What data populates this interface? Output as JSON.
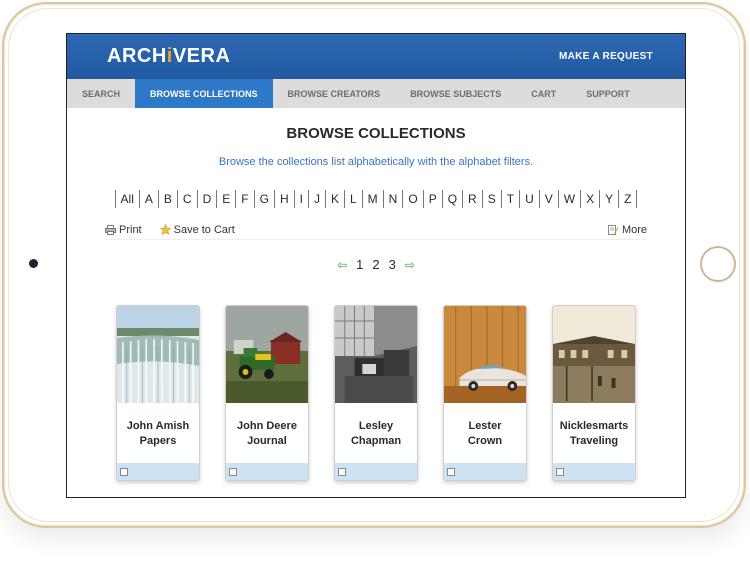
{
  "app": {
    "logo": {
      "part1": "ARCH",
      "part2": "i",
      "part3": "VERA"
    },
    "header_link": "MAKE A REQUEST"
  },
  "nav": {
    "items": [
      "SEARCH",
      "BROWSE COLLECTIONS",
      "BROWSE CREATORS",
      "BROWSE SUBJECTS",
      "CART",
      "SUPPORT"
    ],
    "active": "BROWSE COLLECTIONS"
  },
  "page": {
    "title": "BROWSE COLLECTIONS",
    "subtitle": "Browse the collections list alphabetically with the alphabet filters."
  },
  "alphabet": [
    "All",
    "A",
    "B",
    "C",
    "D",
    "E",
    "F",
    "G",
    "H",
    "I",
    "J",
    "K",
    "L",
    "M",
    "N",
    "O",
    "P",
    "Q",
    "R",
    "S",
    "T",
    "U",
    "V",
    "W",
    "X",
    "Y",
    "Z"
  ],
  "toolbar": {
    "print": "Print",
    "save": "Save to Cart",
    "more": "More"
  },
  "pager": {
    "prev_icon": "left-arrow-icon",
    "next_icon": "right-arrow-icon",
    "pages": [
      "1",
      "2",
      "3"
    ]
  },
  "collections": [
    {
      "title_line1": "John Amish",
      "title_line2": "Papers",
      "image": "waterfall-photo"
    },
    {
      "title_line1": "John Deere",
      "title_line2": "Journal",
      "image": "tractor-photo"
    },
    {
      "title_line1": "Lesley",
      "title_line2": "Chapman",
      "image": "office-bw-photo"
    },
    {
      "title_line1": "Lester",
      "title_line2": "Crown",
      "image": "vintage-car-photo"
    },
    {
      "title_line1": "Nicklesmarts",
      "title_line2": "Traveling",
      "image": "sepia-station-photo"
    }
  ],
  "colors": {
    "header_blue": "#215aa3",
    "nav_active": "#2f77c7",
    "accent_link": "#3a73bd",
    "card_footer": "#cde2f3",
    "frame_gold": "#d9c7a3"
  }
}
